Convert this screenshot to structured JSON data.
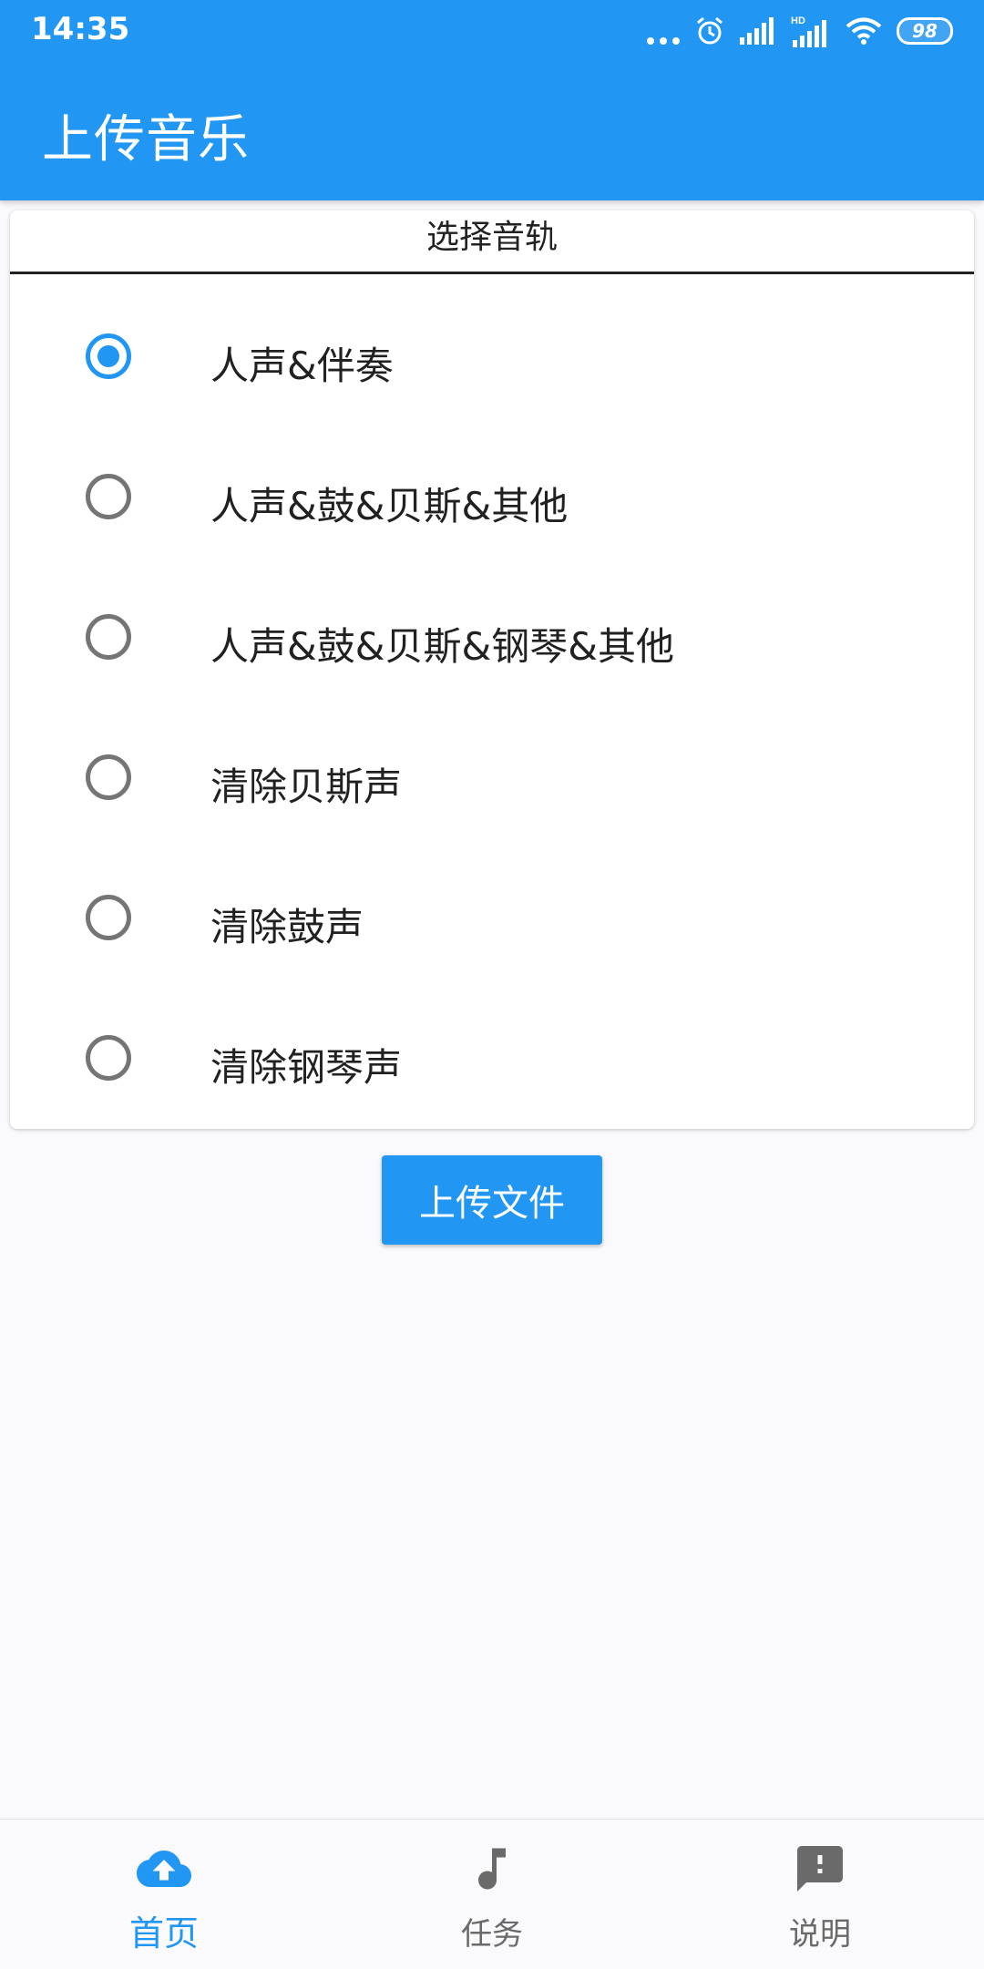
{
  "status_bar": {
    "time": "14:35",
    "battery": "98"
  },
  "app_bar": {
    "title": "上传音乐"
  },
  "track_card": {
    "header": "选择音轨",
    "selected_index": 0,
    "options": [
      {
        "label": "人声&伴奏",
        "checked": true
      },
      {
        "label": "人声&鼓&贝斯&其他",
        "checked": false
      },
      {
        "label": "人声&鼓&贝斯&钢琴&其他",
        "checked": false
      },
      {
        "label": "清除贝斯声",
        "checked": false
      },
      {
        "label": "清除鼓声",
        "checked": false
      },
      {
        "label": "清除钢琴声",
        "checked": false
      }
    ]
  },
  "upload_button": {
    "label": "上传文件"
  },
  "bottom_nav": {
    "items": [
      {
        "label": "首页",
        "icon": "cloud-upload-icon",
        "active": true
      },
      {
        "label": "任务",
        "icon": "music-note-icon",
        "active": false
      },
      {
        "label": "说明",
        "icon": "feedback-icon",
        "active": false
      }
    ]
  },
  "colors": {
    "primary": "#2196f3",
    "inactive": "#6a6a6a",
    "background": "#faf9fb"
  }
}
